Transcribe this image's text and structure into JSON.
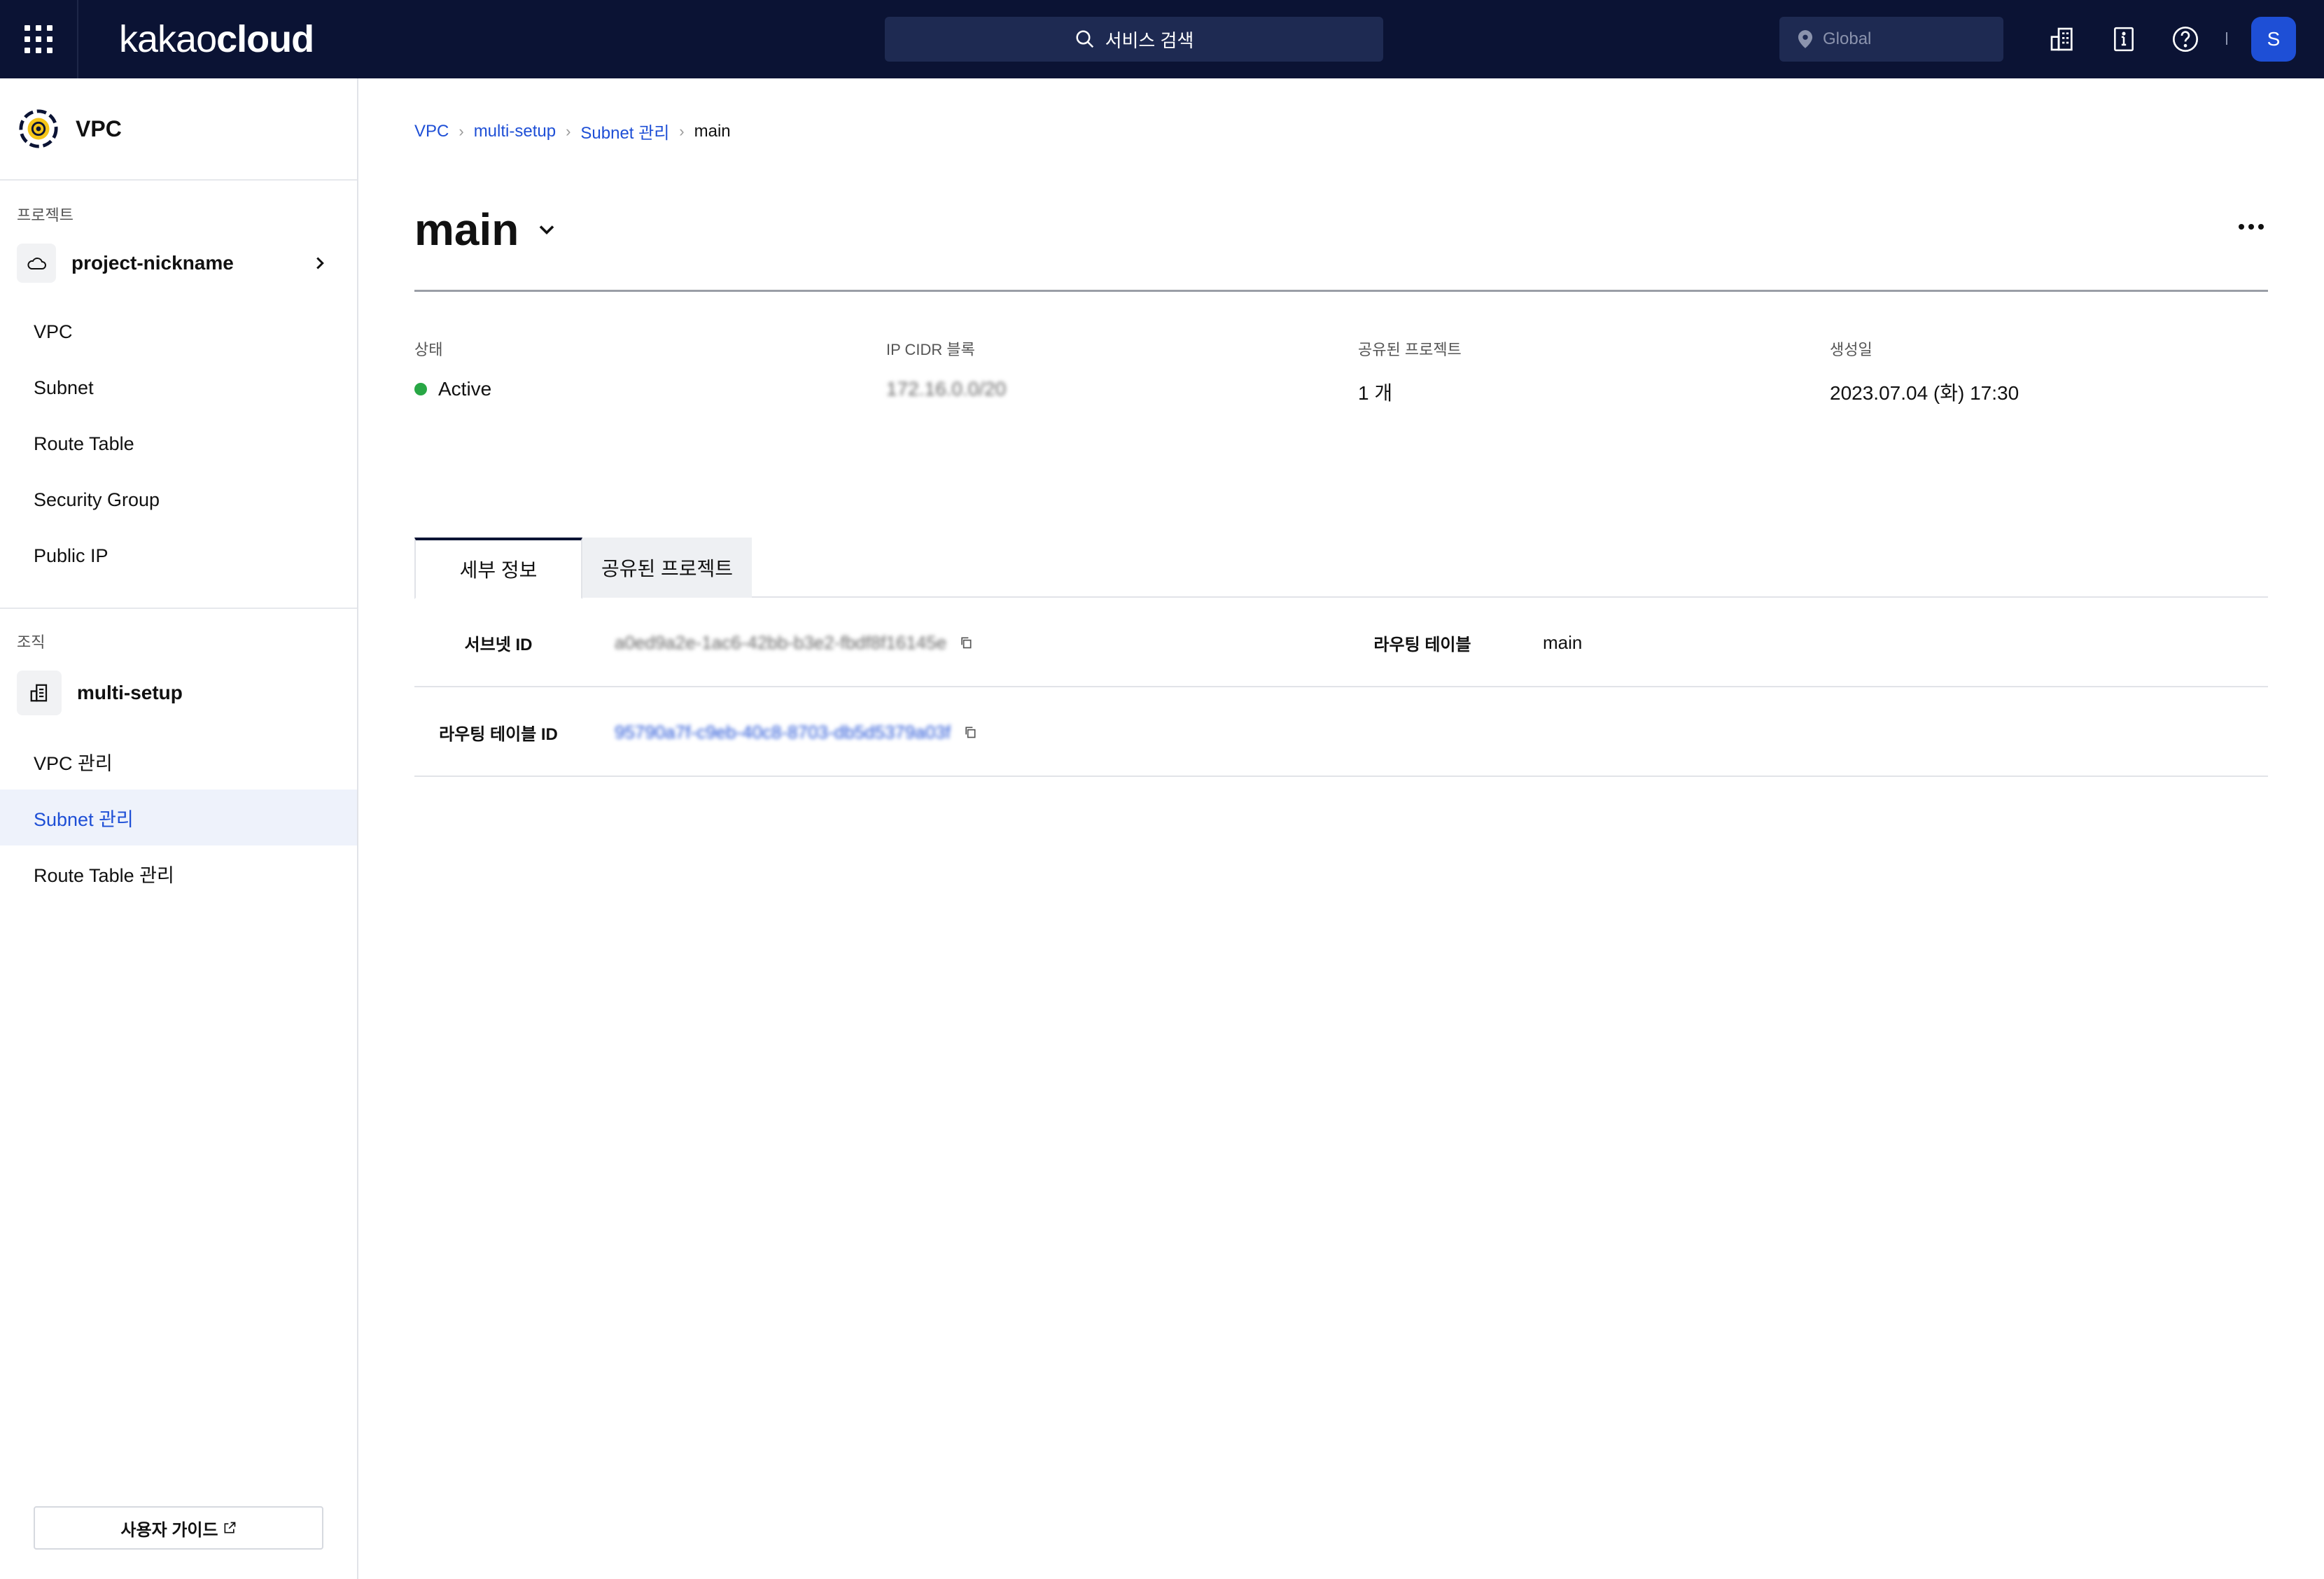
{
  "topbar": {
    "logo_part1": "kakao",
    "logo_part2": "cloud",
    "search_placeholder": "서비스 검색",
    "region": "Global",
    "avatar_initial": "S",
    "icons": [
      "apps-grid-icon",
      "search-icon",
      "location-pin-icon",
      "building-icon",
      "info-book-icon",
      "help-icon"
    ]
  },
  "sidebar": {
    "service_title": "VPC",
    "project_section_label": "프로젝트",
    "project_name": "project-nickname",
    "project_items": [
      "VPC",
      "Subnet",
      "Route Table",
      "Security Group",
      "Public IP"
    ],
    "org_section_label": "조직",
    "org_name": "multi-setup",
    "org_items": [
      "VPC 관리",
      "Subnet 관리",
      "Route Table 관리"
    ],
    "active_item": "Subnet 관리",
    "guide_button": "사용자 가이드"
  },
  "breadcrumb": [
    "VPC",
    "multi-setup",
    "Subnet 관리",
    "main"
  ],
  "page": {
    "title": "main"
  },
  "summary": {
    "status_label": "상태",
    "status_value": "Active",
    "status_color": "#28a745",
    "cidr_label": "IP CIDR 블록",
    "cidr_value": "172.16.0.0/20",
    "shared_label": "공유된 프로젝트",
    "shared_value": "1 개",
    "created_label": "생성일",
    "created_value": "2023.07.04 (화) 17:30"
  },
  "tabs": [
    "세부 정보",
    "공유된 프로젝트"
  ],
  "details": {
    "subnet_id_label": "서브넷 ID",
    "subnet_id_value": "a0ed9a2e-1ac6-42bb-b3e2-fbdf8f16145e",
    "routing_table_label": "라우팅 테이블",
    "routing_table_value": "main",
    "routing_table_id_label": "라우팅 테이블 ID",
    "routing_table_id_value": "95790a7f-c9eb-40c8-8703-db5d5379a03f"
  },
  "colors": {
    "topbar_bg": "#0b1334",
    "accent": "#1e4fd6",
    "active_nav_bg": "#eef2fb"
  }
}
